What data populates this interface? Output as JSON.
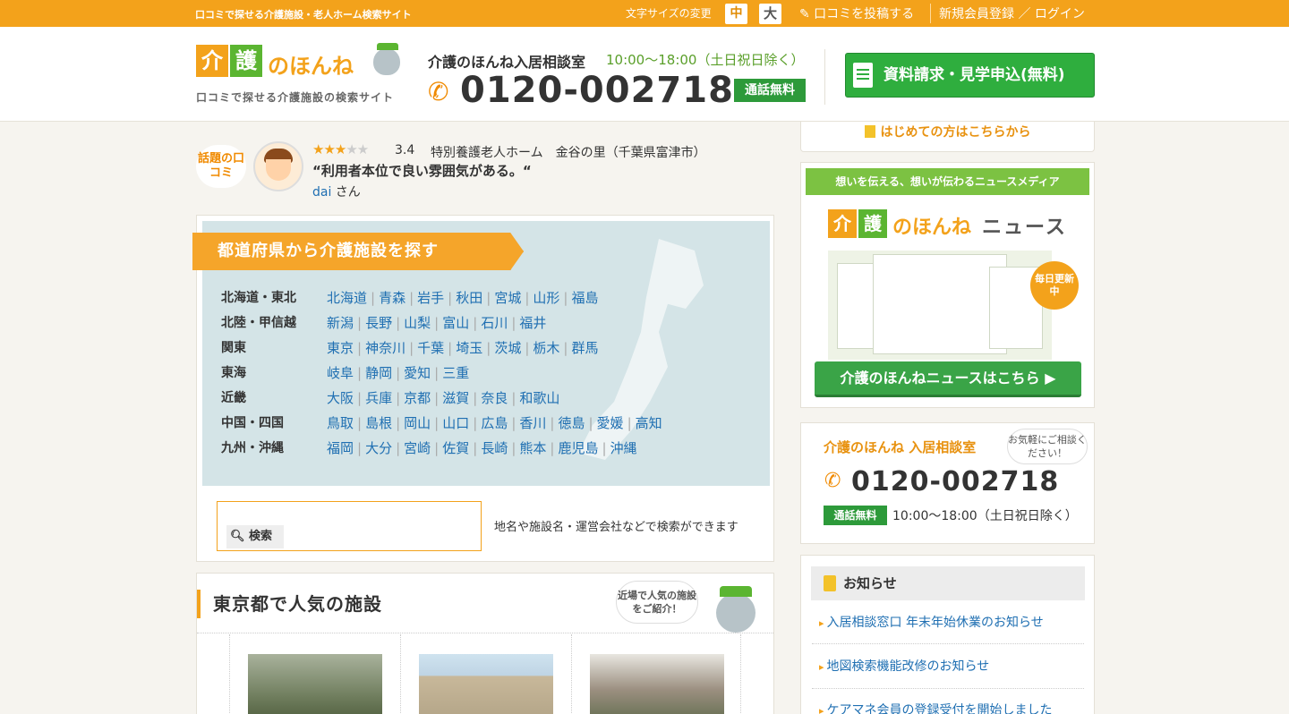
{
  "topbar": {
    "tagline": "口コミで探せる介護施設・老人ホーム検索サイト",
    "font_size_label": "文字サイズの変更",
    "font_mid": "中",
    "font_big": "大",
    "post_review": "✎ 口コミを投稿する",
    "register_login": "新規会員登録 ／ ログイン"
  },
  "header": {
    "logo_k1": "介",
    "logo_k2": "護",
    "logo_honne": "のほんね",
    "logo_sub": "口コミで探せる介護施設の検索サイト",
    "consult_title": "介護のほんね入居相談室",
    "consult_hours": "10:00〜18:00（土日祝日除く）",
    "phone": "0120-002718",
    "free_call": "通話無料",
    "cta_label": "資料請求・見学申込(無料)"
  },
  "topic": {
    "badge": "話題の口コミ",
    "rating": "3.4",
    "stars_on": "★★★",
    "stars_off": "★★",
    "facility": "特別養護老人ホーム　金谷の里（千葉県富津市）",
    "quote": "“利用者本位で良い雰囲気がある。“",
    "user_name": "dai",
    "user_suffix": " さん"
  },
  "prefecture": {
    "title": "都道府県から介護施設を探す",
    "regions": [
      {
        "name": "北海道・東北",
        "prefs": [
          "北海道",
          "青森",
          "岩手",
          "秋田",
          "宮城",
          "山形",
          "福島"
        ]
      },
      {
        "name": "北陸・甲信越",
        "prefs": [
          "新潟",
          "長野",
          "山梨",
          "富山",
          "石川",
          "福井"
        ]
      },
      {
        "name": "関東",
        "prefs": [
          "東京",
          "神奈川",
          "千葉",
          "埼玉",
          "茨城",
          "栃木",
          "群馬"
        ]
      },
      {
        "name": "東海",
        "prefs": [
          "岐阜",
          "静岡",
          "愛知",
          "三重"
        ]
      },
      {
        "name": "近畿",
        "prefs": [
          "大阪",
          "兵庫",
          "京都",
          "滋賀",
          "奈良",
          "和歌山"
        ]
      },
      {
        "name": "中国・四国",
        "prefs": [
          "鳥取",
          "島根",
          "岡山",
          "山口",
          "広島",
          "香川",
          "徳島",
          "愛媛",
          "高知"
        ]
      },
      {
        "name": "九州・沖縄",
        "prefs": [
          "福岡",
          "大分",
          "宮崎",
          "佐賀",
          "長崎",
          "熊本",
          "鹿児島",
          "沖縄"
        ]
      }
    ]
  },
  "search": {
    "value": "",
    "button_label": "検索",
    "hint": "地名や施設名・運営会社などで検索ができます"
  },
  "popular": {
    "title": "東京都で人気の施設",
    "bubble": "近場で人気の施設をご紹介！"
  },
  "sidebar": {
    "beginner": "はじめての方はこちらから",
    "news_header": "想いを伝える、想いが伝わるニュースメディア",
    "news_logo_k1": "介",
    "news_logo_k2": "護",
    "news_logo_honne": "のほんね",
    "news_logo_news": "ニュース",
    "news_daily": "毎日更新中",
    "news_button": "介護のほんねニュースはこちら ▶",
    "consult_title": "介護のほんね 入居相談室",
    "consult_bubble": "お気軽にご相談ください！",
    "consult_phone": "0120-002718",
    "consult_free": "通話無料",
    "consult_hours": "10:00〜18:00（土日祝日除く）",
    "notices_title": "お知らせ",
    "notices": [
      "入居相談窓口 年末年始休業のお知らせ",
      "地図検索機能改修のお知らせ",
      "ケアマネ会員の登録受付を開始しました"
    ]
  },
  "colors": {
    "accent_orange": "#f3a21b",
    "brand_green": "#5bb531",
    "cta_green": "#2fae3e",
    "link_blue": "#1f6fb2"
  }
}
